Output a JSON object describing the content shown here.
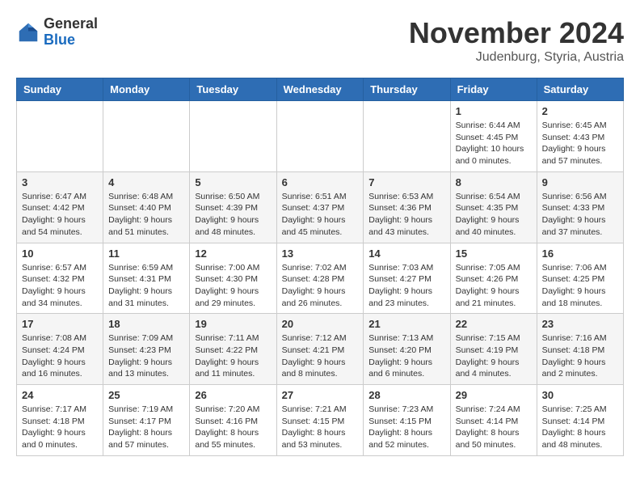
{
  "header": {
    "logo_general": "General",
    "logo_blue": "Blue",
    "month_title": "November 2024",
    "subtitle": "Judenburg, Styria, Austria"
  },
  "calendar": {
    "days_of_week": [
      "Sunday",
      "Monday",
      "Tuesday",
      "Wednesday",
      "Thursday",
      "Friday",
      "Saturday"
    ],
    "weeks": [
      [
        {
          "day": "",
          "info": ""
        },
        {
          "day": "",
          "info": ""
        },
        {
          "day": "",
          "info": ""
        },
        {
          "day": "",
          "info": ""
        },
        {
          "day": "",
          "info": ""
        },
        {
          "day": "1",
          "info": "Sunrise: 6:44 AM\nSunset: 4:45 PM\nDaylight: 10 hours and 0 minutes."
        },
        {
          "day": "2",
          "info": "Sunrise: 6:45 AM\nSunset: 4:43 PM\nDaylight: 9 hours and 57 minutes."
        }
      ],
      [
        {
          "day": "3",
          "info": "Sunrise: 6:47 AM\nSunset: 4:42 PM\nDaylight: 9 hours and 54 minutes."
        },
        {
          "day": "4",
          "info": "Sunrise: 6:48 AM\nSunset: 4:40 PM\nDaylight: 9 hours and 51 minutes."
        },
        {
          "day": "5",
          "info": "Sunrise: 6:50 AM\nSunset: 4:39 PM\nDaylight: 9 hours and 48 minutes."
        },
        {
          "day": "6",
          "info": "Sunrise: 6:51 AM\nSunset: 4:37 PM\nDaylight: 9 hours and 45 minutes."
        },
        {
          "day": "7",
          "info": "Sunrise: 6:53 AM\nSunset: 4:36 PM\nDaylight: 9 hours and 43 minutes."
        },
        {
          "day": "8",
          "info": "Sunrise: 6:54 AM\nSunset: 4:35 PM\nDaylight: 9 hours and 40 minutes."
        },
        {
          "day": "9",
          "info": "Sunrise: 6:56 AM\nSunset: 4:33 PM\nDaylight: 9 hours and 37 minutes."
        }
      ],
      [
        {
          "day": "10",
          "info": "Sunrise: 6:57 AM\nSunset: 4:32 PM\nDaylight: 9 hours and 34 minutes."
        },
        {
          "day": "11",
          "info": "Sunrise: 6:59 AM\nSunset: 4:31 PM\nDaylight: 9 hours and 31 minutes."
        },
        {
          "day": "12",
          "info": "Sunrise: 7:00 AM\nSunset: 4:30 PM\nDaylight: 9 hours and 29 minutes."
        },
        {
          "day": "13",
          "info": "Sunrise: 7:02 AM\nSunset: 4:28 PM\nDaylight: 9 hours and 26 minutes."
        },
        {
          "day": "14",
          "info": "Sunrise: 7:03 AM\nSunset: 4:27 PM\nDaylight: 9 hours and 23 minutes."
        },
        {
          "day": "15",
          "info": "Sunrise: 7:05 AM\nSunset: 4:26 PM\nDaylight: 9 hours and 21 minutes."
        },
        {
          "day": "16",
          "info": "Sunrise: 7:06 AM\nSunset: 4:25 PM\nDaylight: 9 hours and 18 minutes."
        }
      ],
      [
        {
          "day": "17",
          "info": "Sunrise: 7:08 AM\nSunset: 4:24 PM\nDaylight: 9 hours and 16 minutes."
        },
        {
          "day": "18",
          "info": "Sunrise: 7:09 AM\nSunset: 4:23 PM\nDaylight: 9 hours and 13 minutes."
        },
        {
          "day": "19",
          "info": "Sunrise: 7:11 AM\nSunset: 4:22 PM\nDaylight: 9 hours and 11 minutes."
        },
        {
          "day": "20",
          "info": "Sunrise: 7:12 AM\nSunset: 4:21 PM\nDaylight: 9 hours and 8 minutes."
        },
        {
          "day": "21",
          "info": "Sunrise: 7:13 AM\nSunset: 4:20 PM\nDaylight: 9 hours and 6 minutes."
        },
        {
          "day": "22",
          "info": "Sunrise: 7:15 AM\nSunset: 4:19 PM\nDaylight: 9 hours and 4 minutes."
        },
        {
          "day": "23",
          "info": "Sunrise: 7:16 AM\nSunset: 4:18 PM\nDaylight: 9 hours and 2 minutes."
        }
      ],
      [
        {
          "day": "24",
          "info": "Sunrise: 7:17 AM\nSunset: 4:18 PM\nDaylight: 9 hours and 0 minutes."
        },
        {
          "day": "25",
          "info": "Sunrise: 7:19 AM\nSunset: 4:17 PM\nDaylight: 8 hours and 57 minutes."
        },
        {
          "day": "26",
          "info": "Sunrise: 7:20 AM\nSunset: 4:16 PM\nDaylight: 8 hours and 55 minutes."
        },
        {
          "day": "27",
          "info": "Sunrise: 7:21 AM\nSunset: 4:15 PM\nDaylight: 8 hours and 53 minutes."
        },
        {
          "day": "28",
          "info": "Sunrise: 7:23 AM\nSunset: 4:15 PM\nDaylight: 8 hours and 52 minutes."
        },
        {
          "day": "29",
          "info": "Sunrise: 7:24 AM\nSunset: 4:14 PM\nDaylight: 8 hours and 50 minutes."
        },
        {
          "day": "30",
          "info": "Sunrise: 7:25 AM\nSunset: 4:14 PM\nDaylight: 8 hours and 48 minutes."
        }
      ]
    ]
  }
}
